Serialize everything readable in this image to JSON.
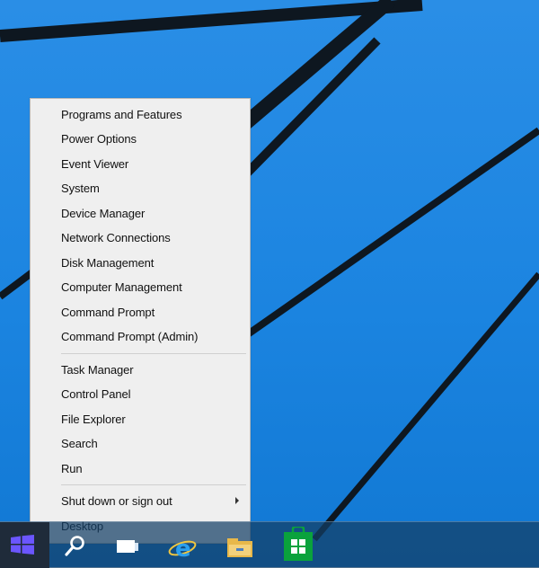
{
  "context_menu": {
    "group1": [
      {
        "label": "Programs and Features"
      },
      {
        "label": "Power Options"
      },
      {
        "label": "Event Viewer"
      },
      {
        "label": "System"
      },
      {
        "label": "Device Manager"
      },
      {
        "label": "Network Connections"
      },
      {
        "label": "Disk Management"
      },
      {
        "label": "Computer Management"
      },
      {
        "label": "Command Prompt"
      },
      {
        "label": "Command Prompt (Admin)"
      }
    ],
    "group2": [
      {
        "label": "Task Manager"
      },
      {
        "label": "Control Panel"
      },
      {
        "label": "File Explorer"
      },
      {
        "label": "Search"
      },
      {
        "label": "Run"
      }
    ],
    "group3": [
      {
        "label": "Shut down or sign out"
      },
      {
        "label": "Desktop"
      }
    ]
  },
  "taskbar": {
    "icons": [
      "windows-logo-icon",
      "search-icon",
      "task-view-icon",
      "internet-explorer-icon",
      "file-explorer-icon",
      "store-icon"
    ]
  },
  "colors": {
    "desktop_blue": "#1b84e0",
    "menu_bg": "#efefef",
    "start_logo": "#6b56ff",
    "store_green": "#0aa23c",
    "ie_blue": "#2aa0f0",
    "folder_yellow": "#e8b84a"
  }
}
